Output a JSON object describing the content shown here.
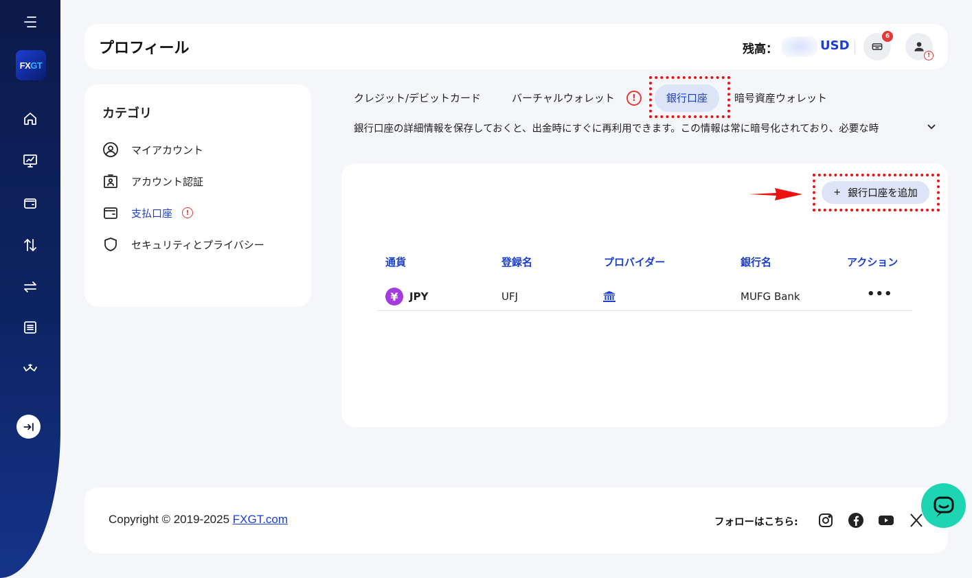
{
  "brand": {
    "logo_text_a": "FX",
    "logo_text_b": "GT"
  },
  "sidebar": {
    "items": [
      {
        "icon": "menu-icon"
      },
      {
        "icon": "home-icon"
      },
      {
        "icon": "chart-icon"
      },
      {
        "icon": "wallet-icon"
      },
      {
        "icon": "transfer-vertical-icon"
      },
      {
        "icon": "transfer-horizontal-icon"
      },
      {
        "icon": "list-icon"
      },
      {
        "icon": "handshake-icon"
      },
      {
        "icon": "expand-icon"
      }
    ]
  },
  "header": {
    "title": "プロフィール",
    "balance_label": "残高：",
    "currency": "USD",
    "notification_count": "6",
    "profile_alert": "!"
  },
  "category": {
    "title": "カテゴリ",
    "items": [
      {
        "label": "マイアカウント",
        "icon": "user-circle-icon"
      },
      {
        "label": "アカウント認証",
        "icon": "id-card-icon"
      },
      {
        "label": "支払口座",
        "icon": "wallet-icon",
        "active": true,
        "alert": "!"
      },
      {
        "label": "セキュリティとプライバシー",
        "icon": "shield-icon"
      }
    ]
  },
  "tabs": [
    {
      "label": "クレジット/デビットカード"
    },
    {
      "label": "バーチャルウォレット",
      "alert": "!"
    },
    {
      "label": "銀行口座",
      "active": true
    },
    {
      "label": "暗号資産ウォレット"
    }
  ],
  "description": "銀行口座の詳細情報を保存しておくと、出金時にすぐに再利用できます。この情報は常に暗号化されており、必要な時",
  "add_button": {
    "plus": "+",
    "label": "銀行口座を追加"
  },
  "table": {
    "headers": [
      "通貨",
      "登録名",
      "プロバイダー",
      "銀行名",
      "アクション"
    ],
    "rows": [
      {
        "currency_symbol": "¥",
        "currency": "JPY",
        "name": "UFJ",
        "provider_icon": "bank-icon",
        "bank": "MUFG Bank",
        "action": "•••"
      }
    ]
  },
  "footer": {
    "copyright": "Copyright © 2019-2025 ",
    "link": "FXGT.com",
    "follow": "フォローはこちら:",
    "socials": [
      "instagram-icon",
      "facebook-icon",
      "youtube-icon",
      "x-icon"
    ]
  },
  "colors": {
    "accent": "#1a3fd1",
    "alert": "#e53935",
    "chat": "#1dd5b3",
    "annotation": "#ee1111"
  }
}
